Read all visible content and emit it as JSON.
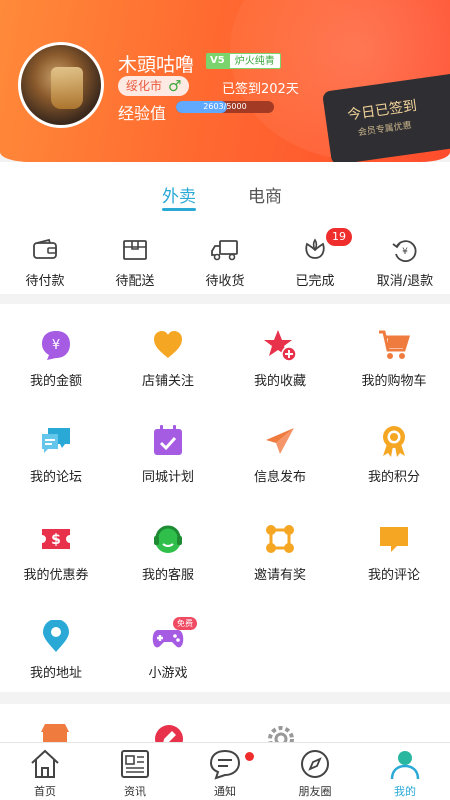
{
  "profile": {
    "username": "木頭咕噜",
    "vip_level": "V5",
    "vip_title": "炉火纯青",
    "city": "绥化市",
    "gender_symbol": "♂",
    "signed_days": "已签到202天",
    "exp_label": "经验值",
    "exp_text": "2603/5000",
    "exp_progress": 0.52,
    "checkin_title": "今日已签到",
    "checkin_subtitle": "会员专属优惠"
  },
  "order_tabs": [
    {
      "label": "外卖",
      "active": true
    },
    {
      "label": "电商",
      "active": false
    }
  ],
  "order_status": [
    {
      "label": "待付款",
      "icon": "wallet-icon"
    },
    {
      "label": "待配送",
      "icon": "box-icon"
    },
    {
      "label": "待收货",
      "icon": "truck-icon"
    },
    {
      "label": "已完成",
      "icon": "flower-icon",
      "badge": "19"
    },
    {
      "label": "取消/退款",
      "icon": "refund-icon"
    }
  ],
  "grid_items": [
    {
      "label": "我的金额",
      "icon": "money-icon",
      "color": "#a65be3"
    },
    {
      "label": "店铺关注",
      "icon": "heart-icon",
      "color": "#f5a623"
    },
    {
      "label": "我的收藏",
      "icon": "star-icon",
      "color": "#e8314a"
    },
    {
      "label": "我的购物车",
      "icon": "cart-icon",
      "color": "#f07b3f"
    },
    {
      "label": "我的论坛",
      "icon": "forum-icon",
      "color": "#2aa9d6"
    },
    {
      "label": "同城计划",
      "icon": "calendar-icon",
      "color": "#a65be3"
    },
    {
      "label": "信息发布",
      "icon": "paper-plane-icon",
      "color": "#f07b3f"
    },
    {
      "label": "我的积分",
      "icon": "medal-icon",
      "color": "#f5a623"
    },
    {
      "label": "我的优惠券",
      "icon": "coupon-icon",
      "color": "#e8314a"
    },
    {
      "label": "我的客服",
      "icon": "headset-icon",
      "color": "#2fbf4a"
    },
    {
      "label": "邀请有奖",
      "icon": "invite-icon",
      "color": "#f5a623"
    },
    {
      "label": "我的评论",
      "icon": "comment-icon",
      "color": "#f5a623"
    },
    {
      "label": "我的地址",
      "icon": "location-icon",
      "color": "#2aa9d6"
    },
    {
      "label": "小游戏",
      "icon": "gamepad-icon",
      "color": "#a65be3",
      "tag": "免费"
    }
  ],
  "bottom_nav": [
    {
      "label": "首页",
      "icon": "home-icon",
      "active": false
    },
    {
      "label": "资讯",
      "icon": "news-icon",
      "active": false
    },
    {
      "label": "通知",
      "icon": "notification-icon",
      "active": false,
      "dot": true
    },
    {
      "label": "朋友圈",
      "icon": "compass-icon",
      "active": false
    },
    {
      "label": "我的",
      "icon": "user-icon",
      "active": true
    }
  ],
  "colors": {
    "header_start": "#ff8a3a",
    "header_end": "#ff4d2d",
    "accent": "#2aa9d6",
    "badge": "#ef2d2d"
  }
}
